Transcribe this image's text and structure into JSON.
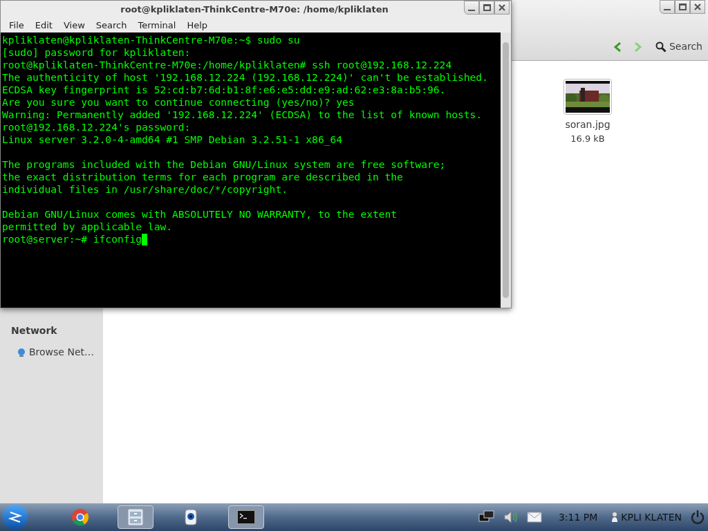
{
  "file_manager": {
    "search_label": "Search",
    "sidebar": {
      "items": [
        {
          "label": "Network",
          "kind": "heading"
        },
        {
          "label": "Browse Net…",
          "kind": "item"
        }
      ]
    },
    "files": [
      {
        "kind": "picture",
        "name": "soran.jpg",
        "size": "16.9 kB"
      }
    ]
  },
  "terminal": {
    "title": "root@kpliklaten-ThinkCentre-M70e: /home/kpliklaten",
    "menu": [
      "File",
      "Edit",
      "View",
      "Search",
      "Terminal",
      "Help"
    ],
    "lines": [
      {
        "kind": "text",
        "text": "kpliklaten@kpliklaten-ThinkCentre-M70e:~$ sudo su"
      },
      {
        "kind": "text",
        "text": "[sudo] password for kpliklaten:"
      },
      {
        "kind": "text",
        "text": "root@kpliklaten-ThinkCentre-M70e:/home/kpliklaten# ssh root@192.168.12.224"
      },
      {
        "kind": "text",
        "text": "The authenticity of host '192.168.12.224 (192.168.12.224)' can't be established."
      },
      {
        "kind": "text",
        "text": "ECDSA key fingerprint is 52:cd:b7:6d:b1:8f:e6:e5:dd:e9:ad:62:e3:8a:b5:96."
      },
      {
        "kind": "text",
        "text": "Are you sure you want to continue connecting (yes/no)? yes"
      },
      {
        "kind": "text",
        "text": "Warning: Permanently added '192.168.12.224' (ECDSA) to the list of known hosts."
      },
      {
        "kind": "text",
        "text": "root@192.168.12.224's password:"
      },
      {
        "kind": "text",
        "text": "Linux server 3.2.0-4-amd64 #1 SMP Debian 3.2.51-1 x86_64"
      },
      {
        "kind": "blank"
      },
      {
        "kind": "text",
        "text": "The programs included with the Debian GNU/Linux system are free software;"
      },
      {
        "kind": "text",
        "text": "the exact distribution terms for each program are described in the"
      },
      {
        "kind": "text",
        "text": "individual files in /usr/share/doc/*/copyright."
      },
      {
        "kind": "blank"
      },
      {
        "kind": "text",
        "text": "Debian GNU/Linux comes with ABSOLUTELY NO WARRANTY, to the extent"
      },
      {
        "kind": "text",
        "text": "permitted by applicable law."
      },
      {
        "kind": "text",
        "text": "root@server:~# ifconfig"
      }
    ]
  },
  "taskbar": {
    "apps": [
      {
        "kind": "browser",
        "selected": false
      },
      {
        "kind": "files",
        "selected": true
      },
      {
        "kind": "webcam",
        "selected": false
      },
      {
        "kind": "terminal",
        "selected": true
      }
    ],
    "clock": "3:11 PM",
    "user": "KPLI KLATEN"
  }
}
